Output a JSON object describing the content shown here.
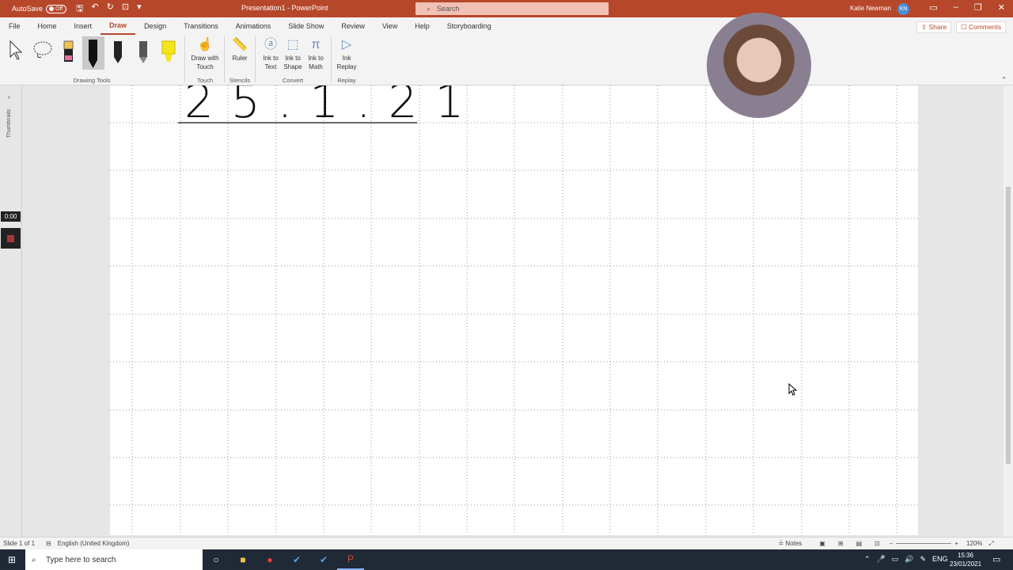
{
  "titlebar": {
    "autosave_label": "AutoSave",
    "autosave_state": "Off",
    "title": "Presentation1 - PowerPoint",
    "search_placeholder": "Search",
    "user_name": "Katie Newman",
    "user_initials": "KN"
  },
  "tabs": [
    "File",
    "Home",
    "Insert",
    "Draw",
    "Design",
    "Transitions",
    "Animations",
    "Slide Show",
    "Review",
    "View",
    "Help",
    "Storyboarding"
  ],
  "active_tab": "Draw",
  "share_label": "Share",
  "comments_label": "Comments",
  "ribbon": {
    "drawing_tools_label": "Drawing Tools",
    "draw_with_touch": "Draw with Touch",
    "touch_label": "Touch",
    "ruler": "Ruler",
    "stencils_label": "Stencils",
    "ink_to_text": "Ink to Text",
    "ink_to_shape": "Ink to Shape",
    "ink_to_math": "Ink to Math",
    "convert_label": "Convert",
    "ink_replay": "Ink Replay",
    "replay_label": "Replay"
  },
  "leftpanel": {
    "thumbnails_label": "Thumbnails",
    "timer": "0:00"
  },
  "slide": {
    "handwritten_date": "25.1.21"
  },
  "statusbar": {
    "slide_info": "Slide 1 of 1",
    "language": "English (United Kingdom)",
    "notes_label": "Notes",
    "zoom": "120%"
  },
  "taskbar": {
    "search_placeholder": "Type here to search",
    "lang": "ENG",
    "time": "15:36",
    "date": "23/01/2021"
  }
}
